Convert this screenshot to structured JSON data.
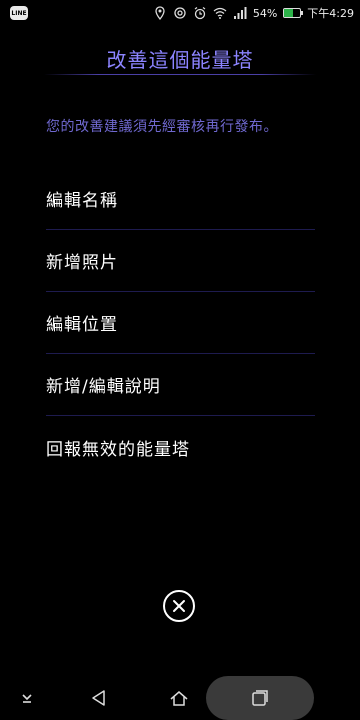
{
  "status_bar": {
    "app_badge": "LINE",
    "battery_percent": "54%",
    "battery_level": 0.54,
    "time": "下午4:29"
  },
  "page": {
    "title": "改善這個能量塔",
    "notice": "您的改善建議須先經審核再行發布。"
  },
  "menu": {
    "items": [
      {
        "label": "編輯名稱"
      },
      {
        "label": "新增照片"
      },
      {
        "label": "編輯位置"
      },
      {
        "label": "新增/編輯說明"
      },
      {
        "label": "回報無效的能量塔"
      }
    ]
  },
  "colors": {
    "accent": "#8c84ff",
    "notice": "#6f68cf",
    "divider": "#1e1b4f"
  },
  "icons": {
    "close": "close-icon",
    "back": "back-icon",
    "home": "home-icon",
    "recent": "recent-apps-icon",
    "collapse": "collapse-icon"
  }
}
